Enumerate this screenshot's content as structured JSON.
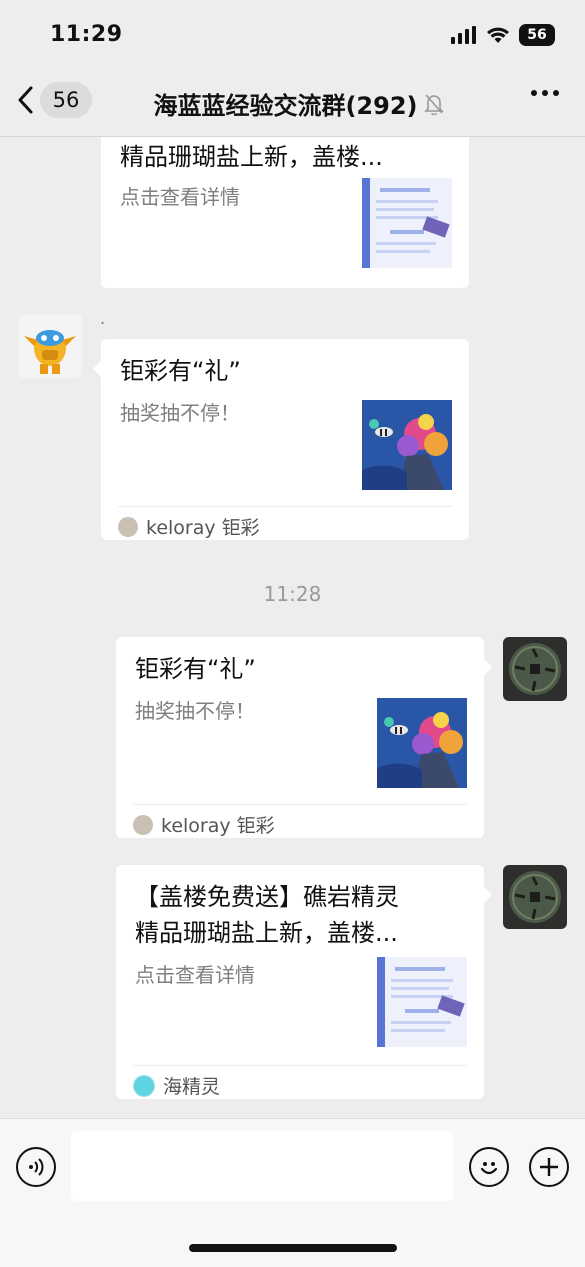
{
  "status_bar": {
    "time": "11:29",
    "battery": "56"
  },
  "nav": {
    "back_count": "56",
    "title": "海蓝蓝经验交流群(292)"
  },
  "messages": [
    {
      "title": "精品珊瑚盐上新，盖楼...",
      "description": "点击查看详情"
    },
    {
      "sender_name": ".",
      "title": "钜彩有“礼”",
      "description": "抽奖抽不停！",
      "source": "keloray 钜彩"
    },
    {
      "timestamp": "11:28"
    },
    {
      "title": "钜彩有“礼”",
      "description": "抽奖抽不停！",
      "source": "keloray 钜彩"
    },
    {
      "title_line1": "【盖楼免费送】礁岩精灵",
      "title_line2": "精品珊瑚盐上新，盖楼...",
      "description": "点击查看详情",
      "source": "海精灵"
    }
  ],
  "icons": {
    "mute": "bell-slash-icon",
    "voice": "voice-icon",
    "emoji": "emoji-icon",
    "plus": "plus-icon"
  }
}
